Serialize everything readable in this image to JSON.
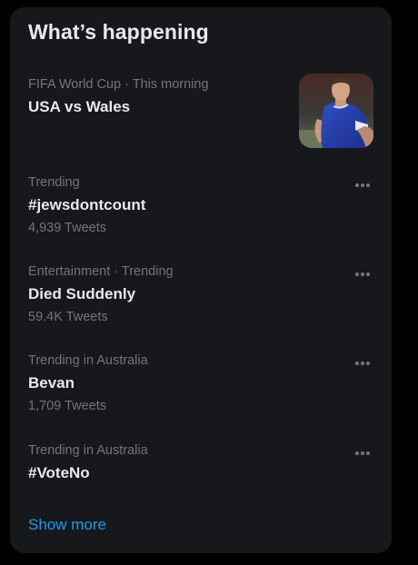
{
  "panel": {
    "title": "What’s happening",
    "show_more_label": "Show more"
  },
  "colors": {
    "background": "#000000",
    "panel": "#16181c",
    "primary_text": "#e7e9ea",
    "secondary_text": "#71767b",
    "accent": "#1d9bf0"
  },
  "featured": {
    "meta": "FIFA World Cup · This morning",
    "name": "USA vs Wales",
    "image_icon": "soccer-player-photo"
  },
  "trends": [
    {
      "meta": "Trending",
      "name": "#jewsdontcount",
      "count": "4,939 Tweets",
      "menu_icon": "more-horizontal-icon"
    },
    {
      "meta": "Entertainment · Trending",
      "name": "Died Suddenly",
      "count": "59.4K Tweets",
      "menu_icon": "more-horizontal-icon"
    },
    {
      "meta": "Trending in Australia",
      "name": "Bevan",
      "count": "1,709 Tweets",
      "menu_icon": "more-horizontal-icon"
    },
    {
      "meta": "Trending in Australia",
      "name": "#VoteNo",
      "count": "",
      "menu_icon": "more-horizontal-icon"
    }
  ]
}
